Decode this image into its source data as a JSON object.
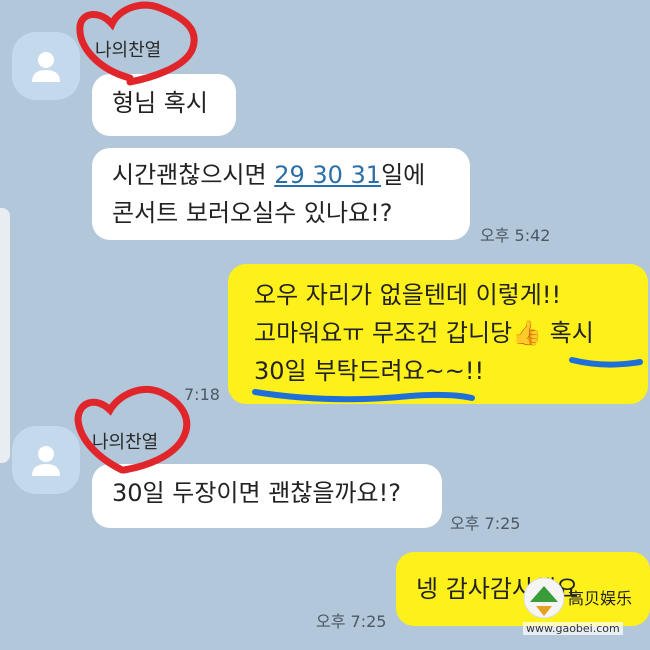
{
  "messages": [
    {
      "sender": "나의찬열",
      "lines": [
        "형님 혹시"
      ]
    },
    {
      "lines_a": "시간괜찮으시면 ",
      "link": "29 30 31",
      "lines_b": "일에",
      "line2": "콘서트 보러오실수 있나요!?",
      "time": "오후 5:42"
    },
    {
      "out1": "오우 자리가 없을텐데 이렇게!!",
      "out2": "고마워요ㅠ 무조건 갑니당",
      "out2_emoji": "👍",
      "out2_tail": " 혹시",
      "out3": "30일 부탁드려요~~!!",
      "time": "7:18"
    },
    {
      "sender": "나의찬열",
      "text": "30일 두장이면 괜찮을까요!?",
      "time": "오후 7:25"
    },
    {
      "out_text": "넹 감사감사해요",
      "time": "오후 7:25"
    }
  ],
  "colors": {
    "background": "#b2c7d9",
    "incoming_bubble": "#ffffff",
    "outgoing_bubble": "#fef01b",
    "heart_scribble": "#e0252b",
    "underline_scribble": "#1e6fd9",
    "link": "#2b6fa9"
  },
  "icons": {
    "avatar": "person-silhouette-icon",
    "thumbs": "thumbs-up-emoji"
  },
  "watermark": {
    "logo_text": "高贝娱乐",
    "url": "www.gaobei.com"
  }
}
